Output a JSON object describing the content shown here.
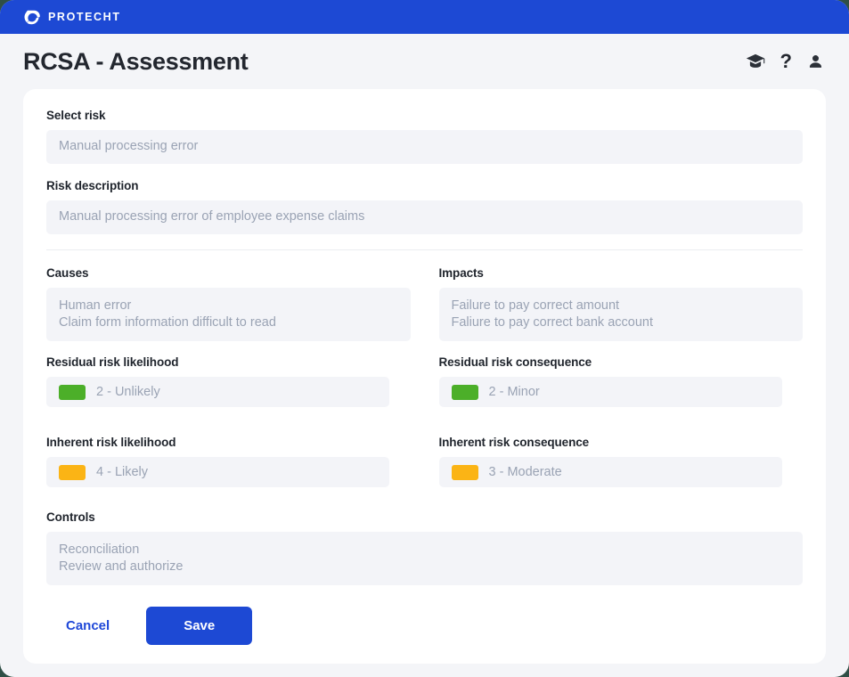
{
  "brand": {
    "name": "PROTECHT",
    "logo_icon": "protecht-logo-icon",
    "bar_color": "#1d49d4"
  },
  "header": {
    "title": "RCSA - Assessment",
    "icons": [
      {
        "name": "graduation-cap-icon",
        "glyph": "training"
      },
      {
        "name": "help-question-icon",
        "glyph": "?"
      },
      {
        "name": "user-account-icon",
        "glyph": "person"
      }
    ]
  },
  "form": {
    "select_risk": {
      "label": "Select risk",
      "value": "Manual processing error"
    },
    "risk_description": {
      "label": "Risk description",
      "value": "Manual processing error of employee expense claims"
    },
    "causes": {
      "label": "Causes",
      "lines": [
        "Human error",
        "Claim form information difficult to read"
      ]
    },
    "impacts": {
      "label": "Impacts",
      "lines": [
        "Failure to pay correct amount",
        "Faliure to pay correct bank account"
      ]
    },
    "residual_likelihood": {
      "label": "Residual risk likelihood",
      "value": "2 - Unlikely",
      "color": "#4caf29"
    },
    "residual_consequence": {
      "label": "Residual risk consequence",
      "value": "2 - Minor",
      "color": "#4caf29"
    },
    "inherent_likelihood": {
      "label": "Inherent risk likelihood",
      "value": "4 - Likely",
      "color": "#fbb415"
    },
    "inherent_consequence": {
      "label": "Inherent risk consequence",
      "value": "3 - Moderate",
      "color": "#fbb415"
    },
    "controls": {
      "label": "Controls",
      "lines": [
        "Reconciliation",
        "Review and authorize"
      ]
    }
  },
  "actions": {
    "cancel_label": "Cancel",
    "save_label": "Save"
  }
}
